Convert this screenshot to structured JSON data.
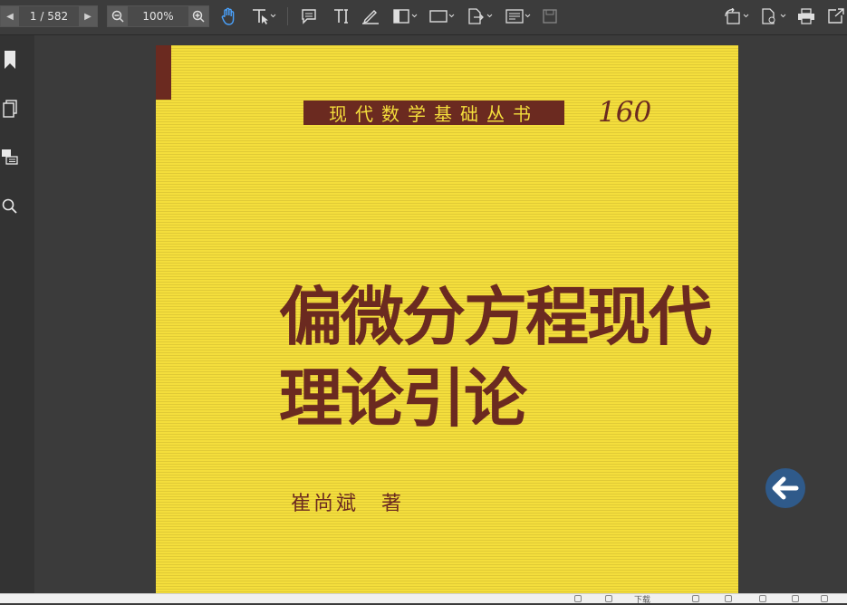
{
  "toolbar": {
    "page_display": "1 / 582",
    "zoom": "100%",
    "icons": [
      "page-prev-icon",
      "page-next-icon",
      "zoom-out-icon",
      "zoom-in-icon",
      "hand-tool-icon",
      "select-text-icon",
      "comment-icon",
      "text-tool-icon",
      "pen-icon",
      "column-icon",
      "rectangle-icon",
      "export-icon",
      "form-icon",
      "save-icon",
      "rotate-icon",
      "page-settings-icon",
      "print-icon",
      "open-external-icon"
    ]
  },
  "sidebar": {
    "items": [
      "bookmark-icon",
      "pages-icon",
      "comments-icon",
      "search-icon"
    ]
  },
  "cover": {
    "series": "现代数学基础丛书",
    "series_number": "160",
    "title_line1": "偏微分方程现代",
    "title_line2": "理论引论",
    "author": "崔尚斌　著"
  },
  "overlay": {
    "back_icon": "back-arrow-icon"
  },
  "statusbar": {
    "download_label": "下载"
  },
  "colors": {
    "cover_yellow": "#f4de3c",
    "cover_maroon": "#6b2a20",
    "toolbar": "#3c3c3c",
    "canvas": "#3b3b3b",
    "back_button": "#2f5a8a"
  }
}
